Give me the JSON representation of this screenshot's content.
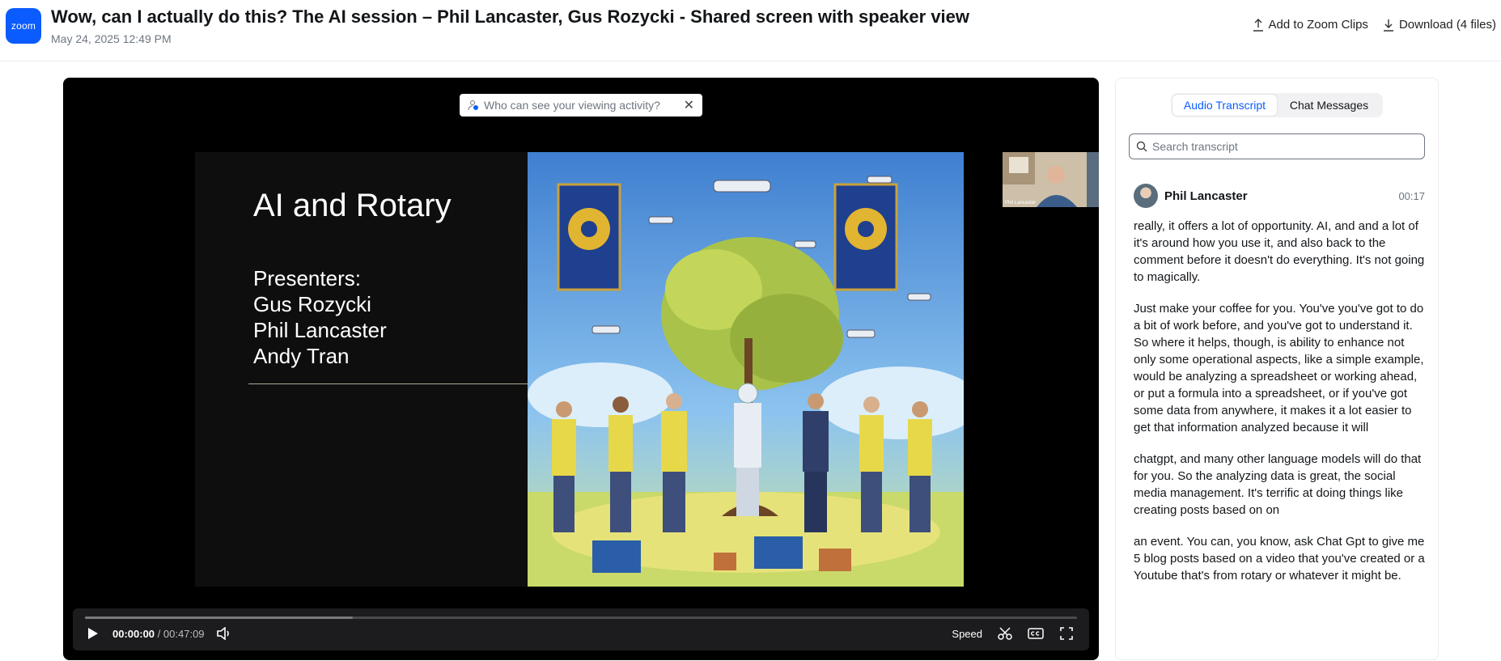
{
  "app": {
    "logo_text": "zoom"
  },
  "header": {
    "title": "Wow, can I actually do this? The AI session – Phil Lancaster, Gus Rozycki - Shared screen with speaker view",
    "subtitle": "May 24, 2025 12:49 PM",
    "actions": {
      "clips_label": "Add to Zoom Clips",
      "download_label": "Download (4 files)"
    }
  },
  "player": {
    "notice_text": "Who can see your viewing activity?",
    "slide": {
      "title": "AI and Rotary",
      "presenters": [
        "Presenters:",
        "Gus Rozycki",
        "Phil Lancaster",
        "Andy Tran"
      ]
    },
    "speaker_thumb_label": "Phil Lancaster",
    "controls": {
      "current_time": "00:00:00",
      "separator": "/",
      "duration": "00:47:09",
      "speed_label": "Speed",
      "buffered_fraction": 0.27
    }
  },
  "panel": {
    "tabs": [
      {
        "label": "Audio Transcript",
        "active": true
      },
      {
        "label": "Chat Messages",
        "active": false
      }
    ],
    "search": {
      "placeholder": "Search transcript"
    },
    "entry": {
      "speaker": "Phil Lancaster",
      "time": "00:17",
      "paragraphs": [
        "really, it offers a lot of opportunity. AI, and and a lot of it's around how you use it, and also back to the comment before it doesn't do everything. It's not going to magically.",
        "Just make your coffee for you. You've you've got to do a bit of work before, and you've got to understand it. So where it helps, though, is ability to enhance not only some operational aspects, like a simple example, would be analyzing a spreadsheet or working ahead, or put a formula into a spreadsheet, or if you've got some data from anywhere, it makes it a lot easier to get that information analyzed because it will",
        "chatgpt, and many other language models will do that for you. So the analyzing data is great, the social media management. It's terrific at doing things like creating posts based on on",
        "an event. You can, you know, ask Chat Gpt to give me 5 blog posts based on a video that you've created or a Youtube that's from rotary or whatever it might be."
      ]
    }
  },
  "colors": {
    "accent": "#0b5cff",
    "player_bg": "#000000",
    "controls_bg": "#1c1c1e"
  }
}
